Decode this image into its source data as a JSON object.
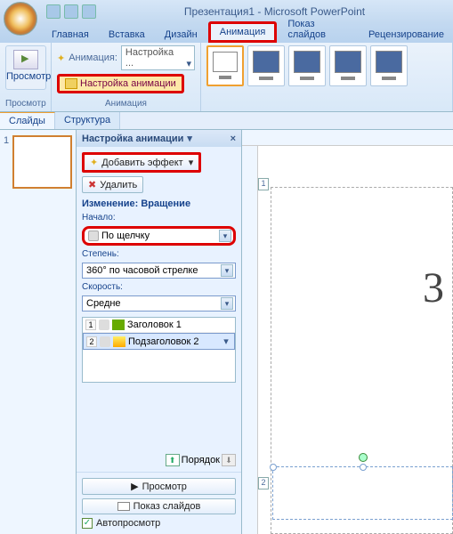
{
  "title": "Презентация1 - Microsoft PowerPoint",
  "tabs": {
    "home": "Главная",
    "insert": "Вставка",
    "design": "Дизайн",
    "anim": "Анимация",
    "show": "Показ слайдов",
    "review": "Рецензирование"
  },
  "ribbon": {
    "preview": "Просмотр",
    "preview_grp": "Просмотр",
    "anim_label": "Анимация:",
    "anim_value": "Настройка ...",
    "custom_btn": "Настройка анимации",
    "anim_grp": "Анимация"
  },
  "sidetabs": {
    "slides": "Слайды",
    "outline": "Структура"
  },
  "pane": {
    "title": "Настройка анимации",
    "add": "Добавить эффект",
    "remove": "Удалить",
    "change": "Изменение: Вращение",
    "start_lb": "Начало:",
    "start_val": "По щелчку",
    "degree_lb": "Степень:",
    "degree_val": "360° по часовой стрелке",
    "speed_lb": "Скорость:",
    "speed_val": "Средне",
    "items": [
      {
        "n": "1",
        "name": "Заголовок 1"
      },
      {
        "n": "2",
        "name": "Подзаголовок 2"
      }
    ],
    "reorder": "Порядок",
    "play": "Просмотр",
    "slideshow": "Показ слайдов",
    "autoprev": "Автопросмотр"
  },
  "canvas": {
    "tag1": "1",
    "tag2": "2",
    "big": "3"
  },
  "thumb": {
    "num": "1"
  }
}
